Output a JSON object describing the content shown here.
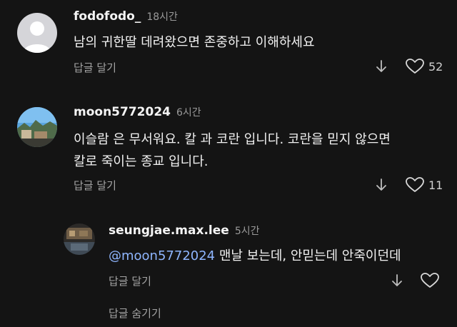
{
  "comments": [
    {
      "username": "fodofodo_",
      "time": "18시간",
      "text": "남의 귀한딸 데려왔으면 존중하고 이해하세요",
      "reply_label": "답글 달기",
      "likes": "52",
      "avatar": "default-person"
    },
    {
      "username": "moon5772024",
      "time": "6시간",
      "text": "이슬람 은 무서워요. 칼 과 코란 입니다.  코란을 믿지 않으면\n칼로 죽이는 종교 입니다.",
      "reply_label": "답글 달기",
      "likes": "11",
      "avatar": "landscape-photo"
    },
    {
      "username": "seungjae.max.lee",
      "time": "5시간",
      "mention": "@moon5772024",
      "text": " 맨날 보는데, 안믿는데 안죽이던데",
      "reply_label": "답글 달기",
      "likes": "",
      "avatar": "interior-photo"
    }
  ],
  "hide_replies_label": "답글 숨기기",
  "colors": {
    "background": "#141414",
    "mention": "#8fb6ff",
    "secondary_text": "#a3a3a3"
  }
}
